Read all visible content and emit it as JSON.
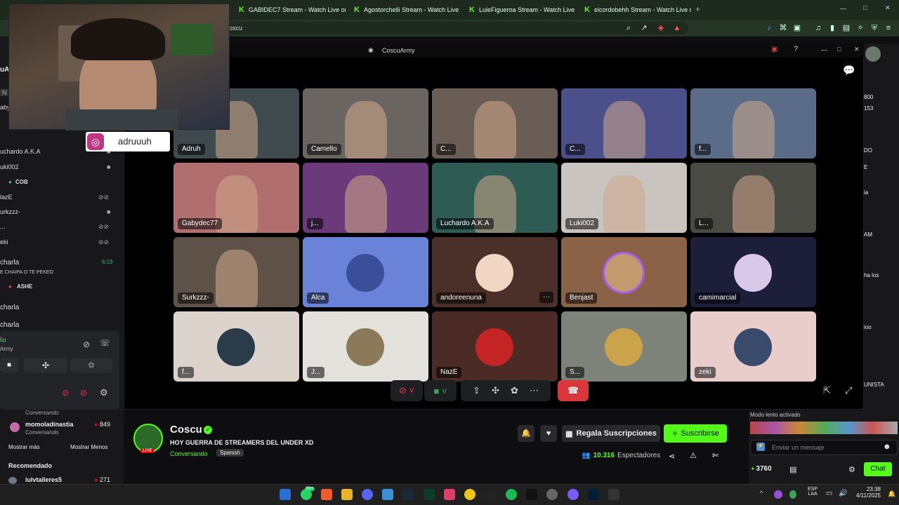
{
  "browser": {
    "tabs": [
      {
        "label": "GABIDEC7 Stream - Watch Live on Ki"
      },
      {
        "label": "Agostorchelli Stream - Watch Live on"
      },
      {
        "label": "LuleFigueroa Stream - Watch Live on"
      },
      {
        "label": "elcordobehh Stream - Watch Live on"
      }
    ],
    "new_tab": "+",
    "address_text": "oscu",
    "window_min": "—",
    "window_max": "□",
    "window_close": "✕"
  },
  "webcam": {
    "instagram_handle": "adruuuh"
  },
  "left_sidebar": {
    "partial_top": "uAr",
    "rows": [
      {
        "label": "N"
      },
      {
        "label": "aby"
      },
      {
        "label": "uchardo A.K.A"
      },
      {
        "label": "uki002"
      },
      {
        "label": "COB"
      },
      {
        "label": "lazE"
      },
      {
        "label": "urkzzz-"
      },
      {
        "label": "..."
      },
      {
        "label": "eki"
      }
    ],
    "charla_1": "charla",
    "charla_time": "6:19",
    "chat_line": "E CHAIPA O TE PEKEO",
    "ashe_badge": "ASHE",
    "charla_2": "charla",
    "charla_3": "charla",
    "voice_status": "lo",
    "voice_channel": "Army",
    "conversando_top": "Conversando",
    "follow_name": "momoladinastia",
    "follow_viewers": "849",
    "follow_sub": "Conversando",
    "show_more": "Mostrar más",
    "show_less": "Mostrar Menos",
    "recommended": "Recomendado",
    "rec_name": "iulvtalleres5",
    "rec_viewers": "271"
  },
  "discord": {
    "title": "CoscuArmy",
    "tiles": [
      {
        "name": "Adruh"
      },
      {
        "name": "Camello"
      },
      {
        "name": "C..."
      },
      {
        "name": "C..."
      },
      {
        "name": "f..."
      },
      {
        "name": "Gabydec77"
      },
      {
        "name": "j..."
      },
      {
        "name": "Luchardo A.K.A"
      },
      {
        "name": "Luki002"
      },
      {
        "name": "L..."
      },
      {
        "name": "Surkzzz-"
      },
      {
        "name": "Alca"
      },
      {
        "name": "andoreenuna"
      },
      {
        "name": "Benjast"
      },
      {
        "name": "camimarcial"
      },
      {
        "name": "f..."
      },
      {
        "name": "J..."
      },
      {
        "name": "NazE"
      },
      {
        "name": "S..."
      },
      {
        "name": "zeki"
      }
    ],
    "more_dots": "···"
  },
  "stream": {
    "channel": "Coscu",
    "title": "HOY GUERRA DE STREAMERS DEL UNDER XD",
    "category": "Conversando",
    "language": "Spanish",
    "live_badge": "LIVE",
    "gift_label": "Regala Suscripciones",
    "subscribe_label": "Suscribirse",
    "viewers": "10.316",
    "viewers_label": "Espectadores"
  },
  "right_panel": {
    "slow_mode": "Modo lento activado",
    "chat_placeholder": "Enviar un mensaje",
    "points": "3760",
    "chat_button": "Chat",
    "viewer_counts": [
      "800",
      "153"
    ],
    "side_snippets": [
      "DO",
      "E",
      "ia",
      "AM",
      "ha los",
      "ioo",
      "UNISTA"
    ]
  },
  "taskbar": {
    "lang_top": "ESP",
    "lang_bottom": "LAA",
    "time": "23:38",
    "date": "4/11/2025",
    "whatsapp_badge": "99+"
  }
}
